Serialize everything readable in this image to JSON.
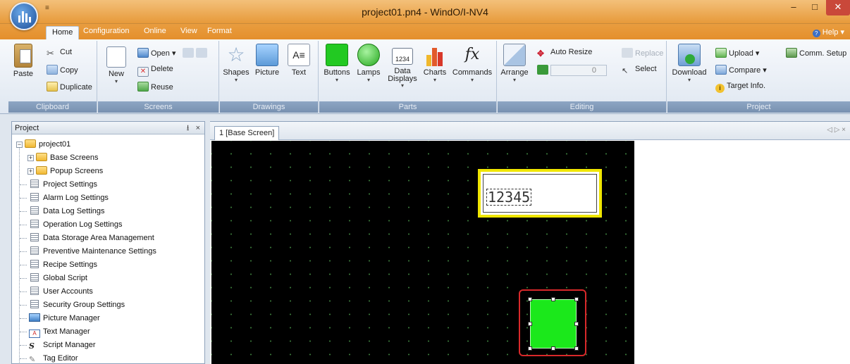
{
  "window": {
    "title": "project01.pn4 - WindO/I-NV4",
    "qat_arrow": "≡",
    "min": "–",
    "max": "□",
    "close": "✕"
  },
  "ribbon_tabs": [
    "Home",
    "Configuration",
    "Online",
    "View",
    "Format"
  ],
  "help_label": "Help",
  "groups": {
    "clipboard": {
      "label": "Clipboard",
      "paste": "Paste",
      "cut": "Cut",
      "copy": "Copy",
      "duplicate": "Duplicate"
    },
    "screens": {
      "label": "Screens",
      "new": "New",
      "open": "Open",
      "delete": "Delete",
      "reuse": "Reuse"
    },
    "drawings": {
      "label": "Drawings",
      "shapes": "Shapes",
      "picture": "Picture",
      "text": "Text"
    },
    "parts": {
      "label": "Parts",
      "buttons": "Buttons",
      "lamps": "Lamps",
      "data_displays_line1": "Data",
      "data_displays_line2": "Displays",
      "charts": "Charts",
      "commands": "Commands",
      "data_icon_text": "1234"
    },
    "editing": {
      "label": "Editing",
      "arrange": "Arrange",
      "auto_resize": "Auto Resize",
      "replace": "Replace",
      "select": "Select",
      "spin_value": "0"
    },
    "project": {
      "label": "Project",
      "download": "Download",
      "upload": "Upload",
      "compare": "Compare",
      "target_info": "Target Info.",
      "comm_setup": "Comm. Setup"
    }
  },
  "project_panel": {
    "title": "Project",
    "pin": "⭳",
    "close": "×",
    "root": "project01",
    "folders": [
      "Base Screens",
      "Popup Screens"
    ],
    "items": [
      "Project Settings",
      "Alarm Log Settings",
      "Data Log Settings",
      "Operation Log Settings",
      "Data Storage Area Management",
      "Preventive Maintenance Settings",
      "Recipe Settings",
      "Global Script",
      "User Accounts",
      "Security Group Settings",
      "Picture Manager",
      "Text Manager",
      "Script Manager",
      "Tag Editor"
    ]
  },
  "editor": {
    "tab_label": "1 [Base Screen]",
    "tab_nav": "◁ ▷ ×",
    "data_display_value": "12345"
  }
}
